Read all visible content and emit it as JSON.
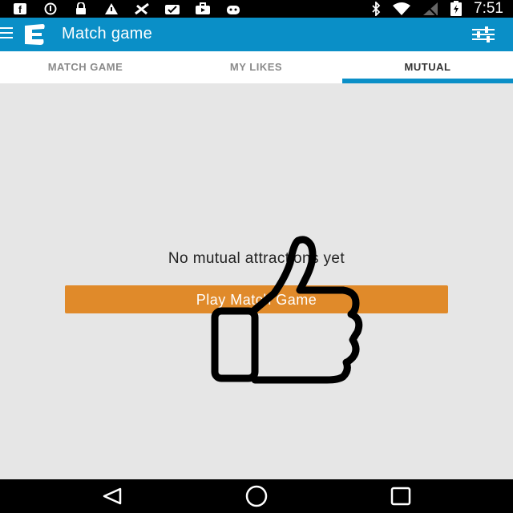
{
  "status_bar": {
    "time": "7:51",
    "icons": [
      "facebook-icon",
      "info-icon",
      "lock-icon",
      "warning-icon",
      "sync-icon",
      "briefcase-icon",
      "media-icon",
      "android-icon",
      "bluetooth-icon",
      "wifi-icon",
      "signal-icon",
      "battery-icon"
    ]
  },
  "app_bar": {
    "title": "Match game",
    "menu_icon": "hamburger-icon",
    "action_icon": "filter-sliders-icon"
  },
  "tabs": [
    {
      "label": "MATCH GAME",
      "active": false
    },
    {
      "label": "MY LIKES",
      "active": false
    },
    {
      "label": "MUTUAL",
      "active": true
    }
  ],
  "content": {
    "empty_message": "No mutual attractions yet",
    "play_button_label": "Play Match Game",
    "overlay_icon": "thumbs-up-icon"
  },
  "colors": {
    "primary": "#0a8fc7",
    "accent": "#e08a2a",
    "background": "#e6e6e6"
  }
}
